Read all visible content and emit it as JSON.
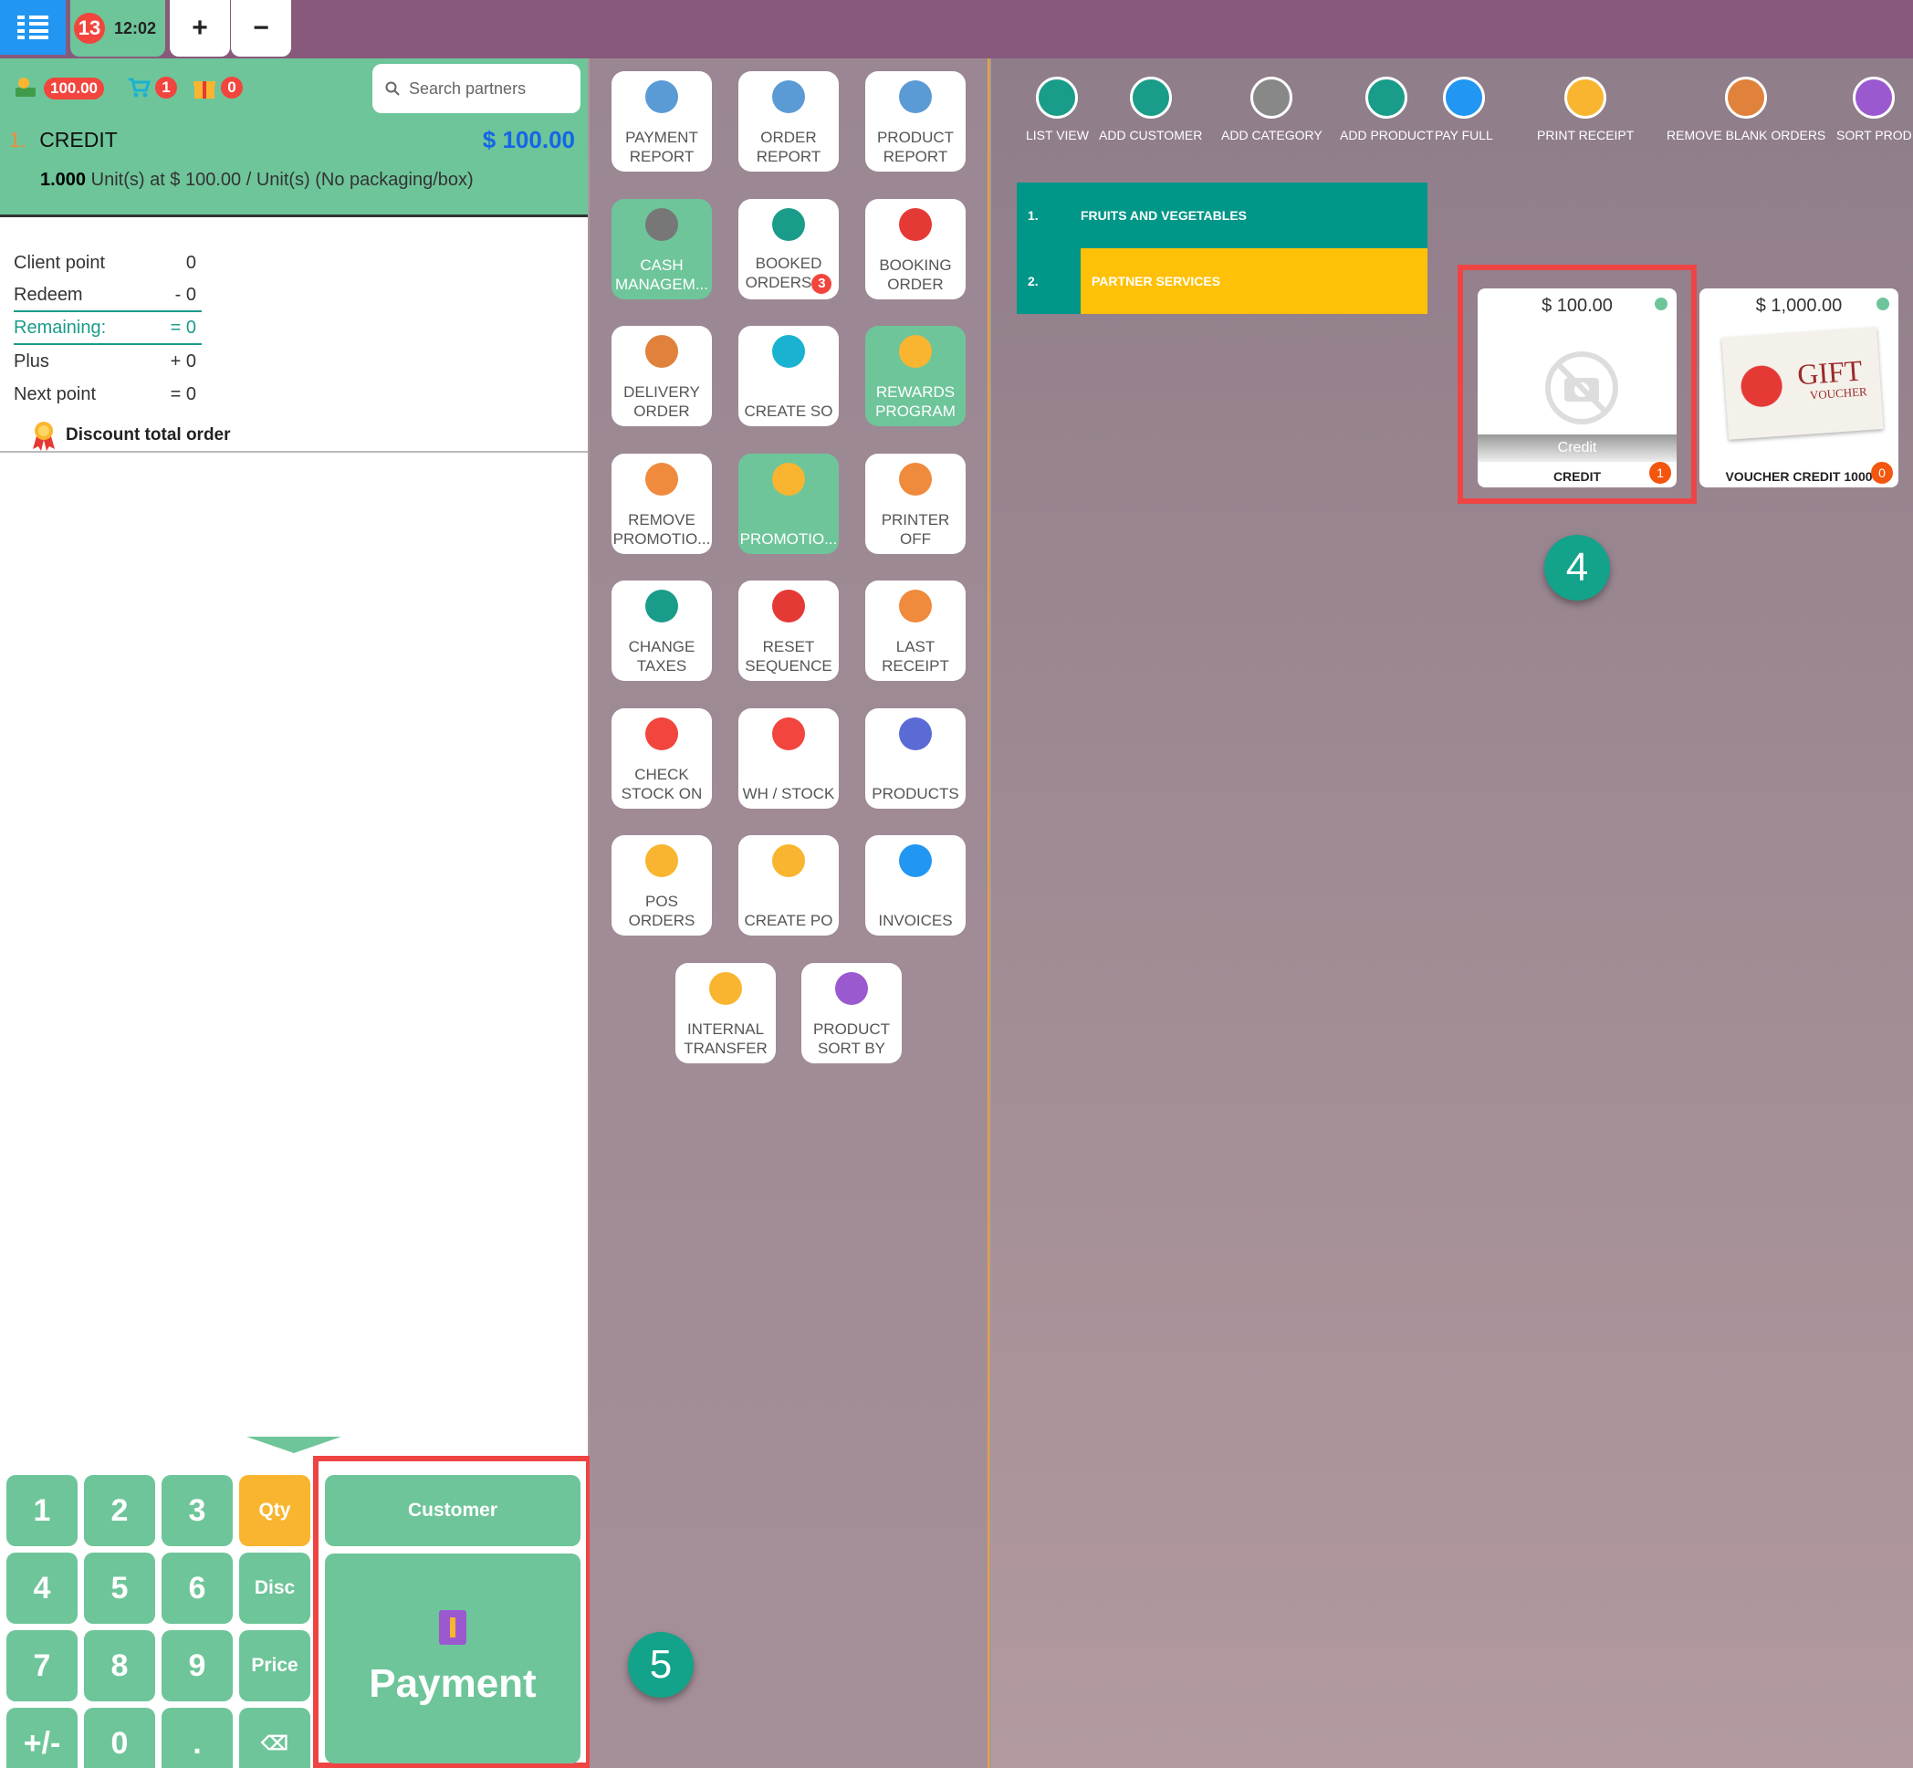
{
  "topbar": {
    "order_count": "13",
    "order_time": "12:02",
    "add_label": "+",
    "remove_label": "−"
  },
  "header": {
    "balance": "100.00",
    "cart_count": "1",
    "gift_count": "0",
    "search_placeholder": "Search partners"
  },
  "order_line": {
    "number": "1.",
    "name": "CREDIT",
    "price": "$ 100.00",
    "qty": "1.000",
    "detail": "Unit(s) at $ 100.00 / Unit(s) (No packaging/box)"
  },
  "points": [
    {
      "label": "Client point",
      "value": "0"
    },
    {
      "label": "Redeem",
      "value": "- 0"
    },
    {
      "label": "Remaining:",
      "value": "= 0"
    },
    {
      "label": "Plus",
      "value": "+ 0"
    },
    {
      "label": "Next point",
      "value": "= 0"
    }
  ],
  "discount_label": "Discount total order",
  "numpad": {
    "keys": [
      "1",
      "2",
      "3",
      "Qty",
      "4",
      "5",
      "6",
      "Disc",
      "7",
      "8",
      "9",
      "Price",
      "+/-",
      "0",
      ".",
      "⌫"
    ],
    "customer_label": "Customer",
    "payment_label": "Payment"
  },
  "actions": [
    {
      "label": "PAYMENT\nREPORT"
    },
    {
      "label": "ORDER\nREPORT"
    },
    {
      "label": "PRODUCT\nREPORT"
    },
    {
      "label": "CASH\nMANAGEM..."
    },
    {
      "label": "BOOKED\nORDERS",
      "badge": "3"
    },
    {
      "label": "BOOKING\nORDER"
    },
    {
      "label": "DELIVERY\nORDER"
    },
    {
      "label": "CREATE SO"
    },
    {
      "label": "REWARDS\nPROGRAM"
    },
    {
      "label": "REMOVE\nPROMOTIO..."
    },
    {
      "label": "PROMOTIO..."
    },
    {
      "label": "PRINTER\nOFF"
    },
    {
      "label": "CHANGE\nTAXES"
    },
    {
      "label": "RESET\nSEQUENCE"
    },
    {
      "label": "LAST\nRECEIPT"
    },
    {
      "label": "CHECK\nSTOCK ON"
    },
    {
      "label": "WH / STOCK"
    },
    {
      "label": "PRODUCTS"
    },
    {
      "label": "POS\nORDERS"
    },
    {
      "label": "CREATE PO"
    },
    {
      "label": "INVOICES"
    },
    {
      "label": "INTERNAL\nTRANSFER"
    },
    {
      "label": "PRODUCT\nSORT BY"
    }
  ],
  "toolbar": [
    {
      "label": "LIST VIEW",
      "icon": "list-view-icon"
    },
    {
      "label": "ADD CUSTOMER",
      "icon": "add-customer-icon"
    },
    {
      "label": "ADD CATEGORY",
      "icon": "add-category-icon"
    },
    {
      "label": "ADD PRODUCT",
      "icon": "add-product-icon"
    },
    {
      "label": "PAY FULL",
      "icon": "pay-full-icon"
    },
    {
      "label": "PRINT RECEIPT",
      "icon": "print-receipt-icon"
    },
    {
      "label": "REMOVE BLANK ORDERS",
      "icon": "remove-blank-orders-icon"
    },
    {
      "label": "SORT PROD",
      "icon": "sort-products-icon"
    }
  ],
  "categories": [
    {
      "number": "1.",
      "name": "FRUITS AND VEGETABLES"
    },
    {
      "number": "2.",
      "name": "PARTNER SERVICES"
    }
  ],
  "products": [
    {
      "price": "$ 100.00",
      "caption": "Credit",
      "name": "CREDIT",
      "qty": "1"
    },
    {
      "price": "$ 1,000.00",
      "image_text": "GIFT",
      "image_subtext": "VOUCHER",
      "name": "VOUCHER CREDIT 1000",
      "qty": "0"
    }
  ],
  "steps": [
    "4",
    "5"
  ],
  "colors": {
    "topbar": "#875a7b",
    "accent_green": "#6ec59a",
    "teal": "#009688",
    "amber": "#ffc107",
    "badge_red": "#f2453d",
    "highlight": "#ef4444"
  }
}
